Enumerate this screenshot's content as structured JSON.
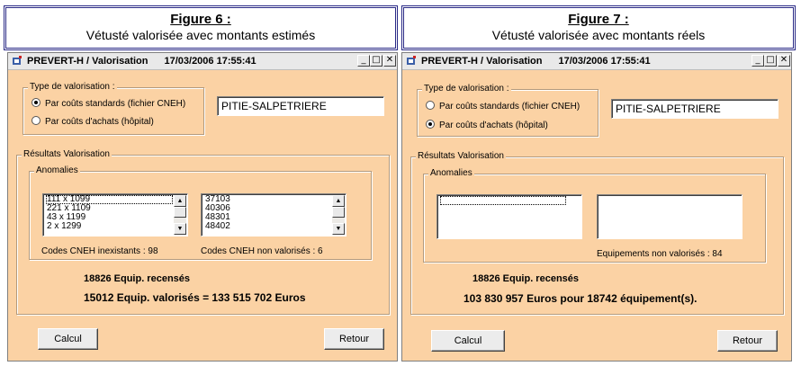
{
  "figures": [
    {
      "caption_title": "Figure 6 :",
      "caption_subtitle": "Vétusté valorisée avec montants estimés",
      "window": {
        "title": "PREVERT-H / Valorisation",
        "datetime": "17/03/2006 17:55:41",
        "minimize_glyph": "_",
        "maximize_glyph": "□",
        "close_glyph": "✕",
        "type_group_label": "Type de valorisation :",
        "radio_standard_label": "Par coûts standards (fichier CNEH)",
        "radio_standard_selected": true,
        "radio_achats_label": "Par coûts d'achats (hôpital)",
        "radio_achats_selected": false,
        "hospital_value": "PITIE-SALPETRIERE",
        "results_group_label": "Résultats Valorisation",
        "anomalies_group_label": "Anomalies",
        "list_left": [
          "111 x 1099",
          "221 x 1109",
          "43 x 1199",
          "2 x 1299"
        ],
        "list_right": [
          "37103",
          "40306",
          "48301",
          "48402"
        ],
        "left_caption": "Codes CNEH inexistants : 98",
        "right_caption": "Codes CNEH non valorisés : 6",
        "equip_recenses": "18826 Equip. recensés",
        "summary": "15012 Equip. valorisés = 133 515 702 Euros",
        "calcul_label": "Calcul",
        "retour_label": "Retour"
      }
    },
    {
      "caption_title": "Figure 7 :",
      "caption_subtitle": "Vétusté valorisée avec montants réels",
      "window": {
        "title": "PREVERT-H / Valorisation",
        "datetime": "17/03/2006 17:55:41",
        "minimize_glyph": "_",
        "maximize_glyph": "□",
        "close_glyph": "✕",
        "type_group_label": "Type de valorisation :",
        "radio_standard_label": "Par coûts standards (fichier CNEH)",
        "radio_standard_selected": false,
        "radio_achats_label": "Par coûts d'achats (hôpital)",
        "radio_achats_selected": true,
        "hospital_value": "PITIE-SALPETRIERE",
        "results_group_label": "Résultats Valorisation",
        "anomalies_group_label": "Anomalies",
        "list_left": [],
        "list_right": [],
        "left_caption": "",
        "right_caption": "Equipements non valorisés : 84",
        "equip_recenses": "18826 Equip. recensés",
        "summary": "103 830 957 Euros pour 18742 équipement(s).",
        "calcul_label": "Calcul",
        "retour_label": "Retour"
      }
    }
  ],
  "colors": {
    "window_bg": "#fbd2a4",
    "caption_border": "#2a2a86",
    "titlebar_bg": "#e9e9e9"
  },
  "icons": {
    "app_icon": "prevert-app-icon",
    "scroll_up": "scroll-up-arrow-icon",
    "scroll_down": "scroll-down-arrow-icon"
  }
}
